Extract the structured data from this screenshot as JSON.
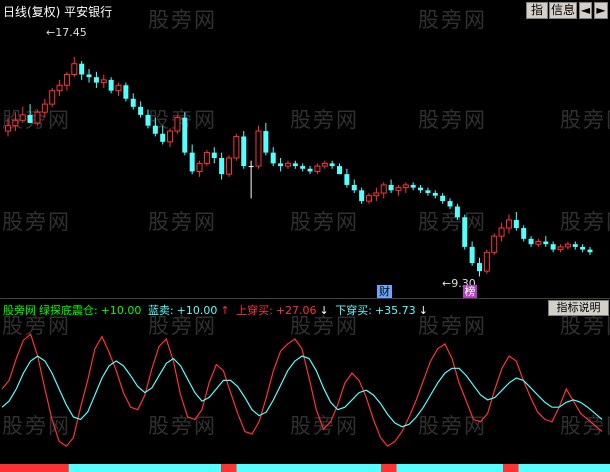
{
  "header": {
    "stock_title": "日线(复权) 平安银行",
    "btn_indicator": "指",
    "btn_info": "信息",
    "btn_prev": "◄",
    "btn_next": "►"
  },
  "watermark": "股旁网",
  "markers": {
    "high_label": "17.45",
    "low_label": "9.30",
    "badge_finance": "财",
    "badge_rank": "榜"
  },
  "indicator": {
    "site": "股旁网",
    "name": "绿探底震仓:",
    "name_value": "+10.00",
    "blue_label": "蓝卖:",
    "blue_value": "+10.00",
    "blue_arrow": "↑",
    "up_label": "上穿买:",
    "up_value": "+27.06",
    "up_arrow": "↓",
    "down_label": "下穿买:",
    "down_value": "+35.73",
    "down_arrow": "↓",
    "help_button": "指标说明"
  },
  "colors": {
    "up_candle": "#ff3232",
    "down_candle": "#54ffff",
    "flat_candle": "#ffffff",
    "red_line": "#ff3232",
    "cyan_line": "#54ffff",
    "green_text": "#00ff00",
    "yellow_text": "#ffff00",
    "background": "#000000"
  },
  "chart_data": [
    {
      "type": "candlestick",
      "title": "平安银行",
      "high_mark": 17.45,
      "low_mark": 9.3,
      "ylim": [
        8.8,
        18.6
      ],
      "candles": [
        [
          14.7,
          15.2,
          14.5,
          14.9
        ],
        [
          14.9,
          15.4,
          14.7,
          15.1
        ],
        [
          15.1,
          15.6,
          15.0,
          15.3
        ],
        [
          15.3,
          15.7,
          15.1,
          15.0
        ],
        [
          15.0,
          15.5,
          14.9,
          15.4
        ],
        [
          15.4,
          15.9,
          15.2,
          15.7
        ],
        [
          15.7,
          16.3,
          15.6,
          16.2
        ],
        [
          16.2,
          16.6,
          16.0,
          16.4
        ],
        [
          16.4,
          16.9,
          16.2,
          16.8
        ],
        [
          16.8,
          17.45,
          16.7,
          17.2
        ],
        [
          17.2,
          17.3,
          16.6,
          16.8
        ],
        [
          16.8,
          17.0,
          16.5,
          16.7
        ],
        [
          16.7,
          16.9,
          16.3,
          16.5
        ],
        [
          16.5,
          16.8,
          16.3,
          16.6
        ],
        [
          16.6,
          16.7,
          16.1,
          16.2
        ],
        [
          16.2,
          16.5,
          16.0,
          16.4
        ],
        [
          16.4,
          16.5,
          15.8,
          15.9
        ],
        [
          15.9,
          16.1,
          15.5,
          15.6
        ],
        [
          15.6,
          15.8,
          15.2,
          15.3
        ],
        [
          15.3,
          15.5,
          14.8,
          14.9
        ],
        [
          14.9,
          15.2,
          14.5,
          14.6
        ],
        [
          14.6,
          14.9,
          14.2,
          14.3
        ],
        [
          14.3,
          14.8,
          14.1,
          14.7
        ],
        [
          14.7,
          15.3,
          14.6,
          15.2
        ],
        [
          15.2,
          15.4,
          13.8,
          13.9
        ],
        [
          13.9,
          14.2,
          13.1,
          13.2
        ],
        [
          13.2,
          13.6,
          13.0,
          13.5
        ],
        [
          13.5,
          14.0,
          13.4,
          13.9
        ],
        [
          13.9,
          14.1,
          13.5,
          13.7
        ],
        [
          13.7,
          13.9,
          12.9,
          13.1
        ],
        [
          13.1,
          13.8,
          13.0,
          13.7
        ],
        [
          13.7,
          14.6,
          13.6,
          14.5
        ],
        [
          14.5,
          14.7,
          13.3,
          13.4
        ],
        [
          13.4,
          13.6,
          12.2,
          13.4
        ],
        [
          13.4,
          14.9,
          13.3,
          14.7
        ],
        [
          14.7,
          15.0,
          13.8,
          13.9
        ],
        [
          13.9,
          14.1,
          13.4,
          13.5
        ],
        [
          13.5,
          13.7,
          13.2,
          13.4
        ],
        [
          13.4,
          13.6,
          13.3,
          13.5
        ],
        [
          13.5,
          13.6,
          13.3,
          13.4
        ],
        [
          13.4,
          13.5,
          13.2,
          13.3
        ],
        [
          13.3,
          13.4,
          13.1,
          13.2
        ],
        [
          13.2,
          13.5,
          13.1,
          13.4
        ],
        [
          13.4,
          13.6,
          13.3,
          13.5
        ],
        [
          13.5,
          13.6,
          13.3,
          13.4
        ],
        [
          13.4,
          13.5,
          13.2,
          13.1
        ],
        [
          13.1,
          13.3,
          12.6,
          12.7
        ],
        [
          12.7,
          12.9,
          12.4,
          12.5
        ],
        [
          12.5,
          12.6,
          12.0,
          12.1
        ],
        [
          12.1,
          12.4,
          12.0,
          12.3
        ],
        [
          12.3,
          12.6,
          12.1,
          12.4
        ],
        [
          12.4,
          12.8,
          12.2,
          12.7
        ],
        [
          12.7,
          12.9,
          12.4,
          12.5
        ],
        [
          12.5,
          12.7,
          12.3,
          12.6
        ],
        [
          12.6,
          12.8,
          12.4,
          12.7
        ],
        [
          12.7,
          12.8,
          12.5,
          12.6
        ],
        [
          12.6,
          12.7,
          12.4,
          12.5
        ],
        [
          12.5,
          12.6,
          12.3,
          12.4
        ],
        [
          12.4,
          12.5,
          12.2,
          12.3
        ],
        [
          12.3,
          12.4,
          12.0,
          12.1
        ],
        [
          12.1,
          12.2,
          11.8,
          11.9
        ],
        [
          11.9,
          12.0,
          11.4,
          11.5
        ],
        [
          11.5,
          11.6,
          10.3,
          10.4
        ],
        [
          10.4,
          10.6,
          9.7,
          9.8
        ],
        [
          9.8,
          10.0,
          9.3,
          9.5
        ],
        [
          9.5,
          10.3,
          9.4,
          10.2
        ],
        [
          10.2,
          10.9,
          10.1,
          10.8
        ],
        [
          10.8,
          11.3,
          10.6,
          11.1
        ],
        [
          11.1,
          11.6,
          10.9,
          11.4
        ],
        [
          11.4,
          11.7,
          11.0,
          11.1
        ],
        [
          11.1,
          11.2,
          10.6,
          10.7
        ],
        [
          10.7,
          10.8,
          10.4,
          10.5
        ],
        [
          10.5,
          10.7,
          10.4,
          10.6
        ],
        [
          10.6,
          10.8,
          10.4,
          10.5
        ],
        [
          10.5,
          10.6,
          10.2,
          10.3
        ],
        [
          10.3,
          10.5,
          10.2,
          10.4
        ],
        [
          10.4,
          10.6,
          10.3,
          10.5
        ],
        [
          10.5,
          10.6,
          10.3,
          10.4
        ],
        [
          10.4,
          10.5,
          10.2,
          10.3
        ],
        [
          10.3,
          10.4,
          10.1,
          10.2
        ]
      ]
    },
    {
      "type": "line",
      "title": "绿探底震仓",
      "ylim": [
        -5,
        110
      ],
      "series": [
        {
          "name": "上穿买",
          "color": "#ff3232",
          "values": [
            55,
            62,
            80,
            95,
            100,
            82,
            55,
            30,
            12,
            8,
            15,
            40,
            62,
            88,
            98,
            85,
            70,
            52,
            40,
            38,
            50,
            72,
            90,
            96,
            78,
            50,
            32,
            30,
            38,
            60,
            75,
            70,
            52,
            35,
            20,
            18,
            28,
            48,
            70,
            86,
            92,
            96,
            88,
            64,
            38,
            22,
            28,
            42,
            60,
            68,
            62,
            48,
            30,
            15,
            8,
            12,
            20,
            32,
            46,
            62,
            78,
            88,
            92,
            80,
            60,
            45,
            30,
            28,
            35,
            55,
            72,
            82,
            78,
            62,
            48,
            36,
            30,
            28,
            40,
            55,
            45,
            35,
            30,
            25,
            20
          ]
        },
        {
          "name": "下穿买",
          "color": "#54ffff",
          "values": [
            40,
            45,
            55,
            68,
            78,
            82,
            78,
            68,
            55,
            42,
            32,
            30,
            36,
            50,
            64,
            74,
            78,
            74,
            66,
            57,
            52,
            56,
            66,
            76,
            80,
            74,
            63,
            52,
            45,
            48,
            55,
            62,
            62,
            57,
            48,
            38,
            33,
            36,
            46,
            58,
            70,
            78,
            82,
            80,
            70,
            56,
            44,
            38,
            40,
            46,
            52,
            54,
            50,
            43,
            34,
            27,
            24,
            26,
            32,
            40,
            50,
            60,
            68,
            72,
            72,
            66,
            58,
            50,
            46,
            48,
            54,
            60,
            64,
            62,
            56,
            50,
            44,
            40,
            40,
            44,
            46,
            44,
            40,
            35,
            30
          ]
        }
      ],
      "bottom_strip": [
        {
          "color": "#ff3232",
          "from": 0,
          "to": 9
        },
        {
          "color": "#54ffff",
          "from": 9,
          "to": 29
        },
        {
          "color": "#ff3232",
          "from": 29,
          "to": 31
        },
        {
          "color": "#54ffff",
          "from": 31,
          "to": 50
        },
        {
          "color": "#ff3232",
          "from": 50,
          "to": 52
        },
        {
          "color": "#54ffff",
          "from": 52,
          "to": 66
        },
        {
          "color": "#ff3232",
          "from": 66,
          "to": 68
        },
        {
          "color": "#54ffff",
          "from": 68,
          "to": 84
        }
      ]
    }
  ]
}
